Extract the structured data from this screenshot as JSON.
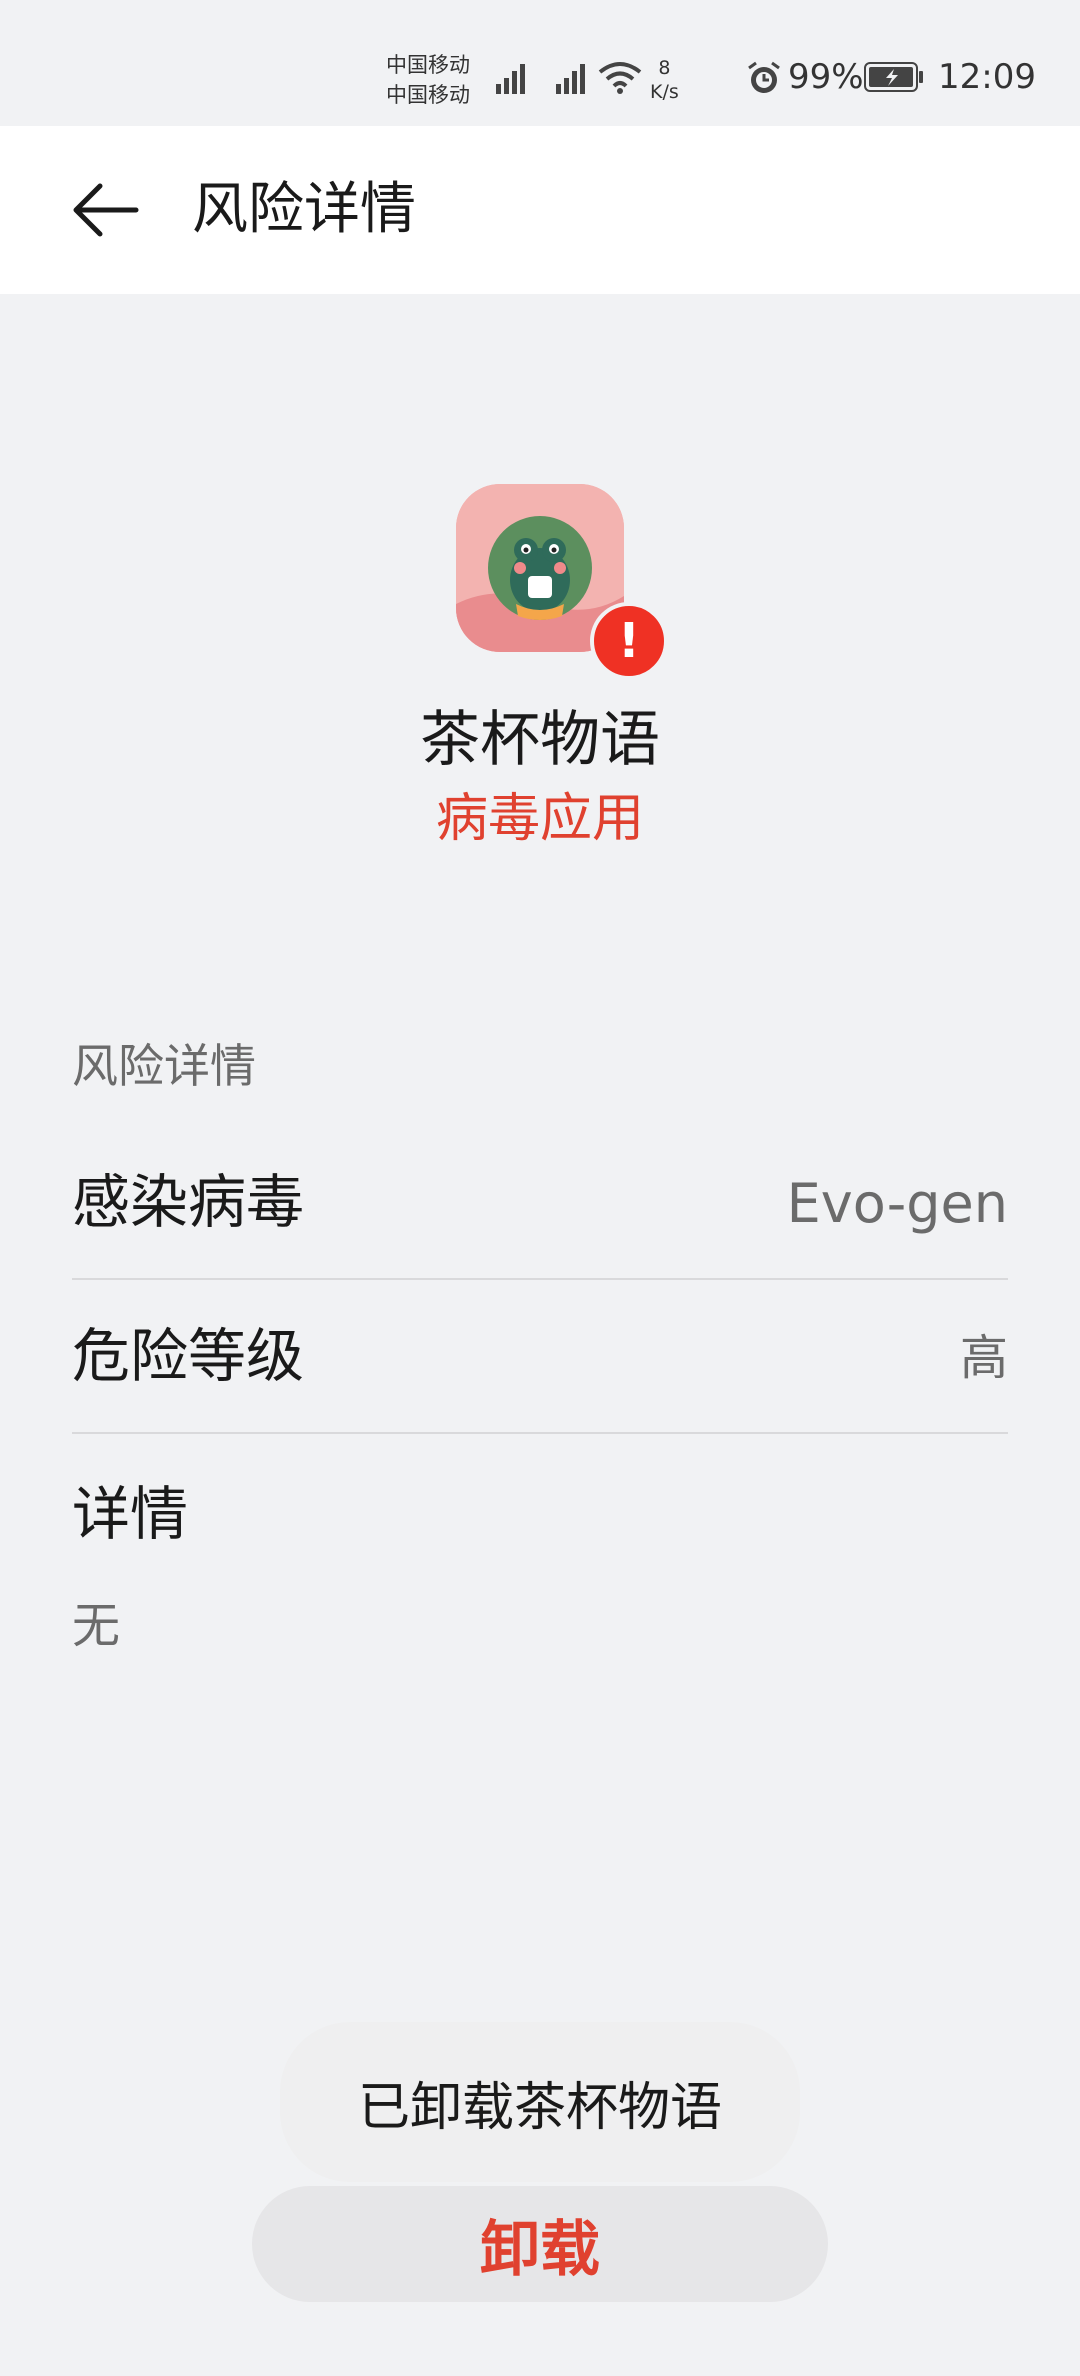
{
  "status_bar": {
    "carrier1": "中国移动",
    "carrier2": "中国移动",
    "speed_value": "8",
    "speed_unit": "K/s",
    "battery": "99%",
    "time": "12:09"
  },
  "app_bar": {
    "title": "风险详情"
  },
  "app": {
    "name": "茶杯物语",
    "status": "病毒应用"
  },
  "details": {
    "section_label": "风险详情",
    "rows": [
      {
        "key": "感染病毒",
        "value": "Evo-gen"
      },
      {
        "key": "危险等级",
        "value": "高"
      }
    ],
    "info_title": "详情",
    "info_value": "无"
  },
  "toast": "已卸载茶杯物语",
  "uninstall_button": "卸载",
  "colors": {
    "danger": "#e0412f",
    "warn_badge": "#ef3124",
    "background": "#f1f2f4"
  }
}
